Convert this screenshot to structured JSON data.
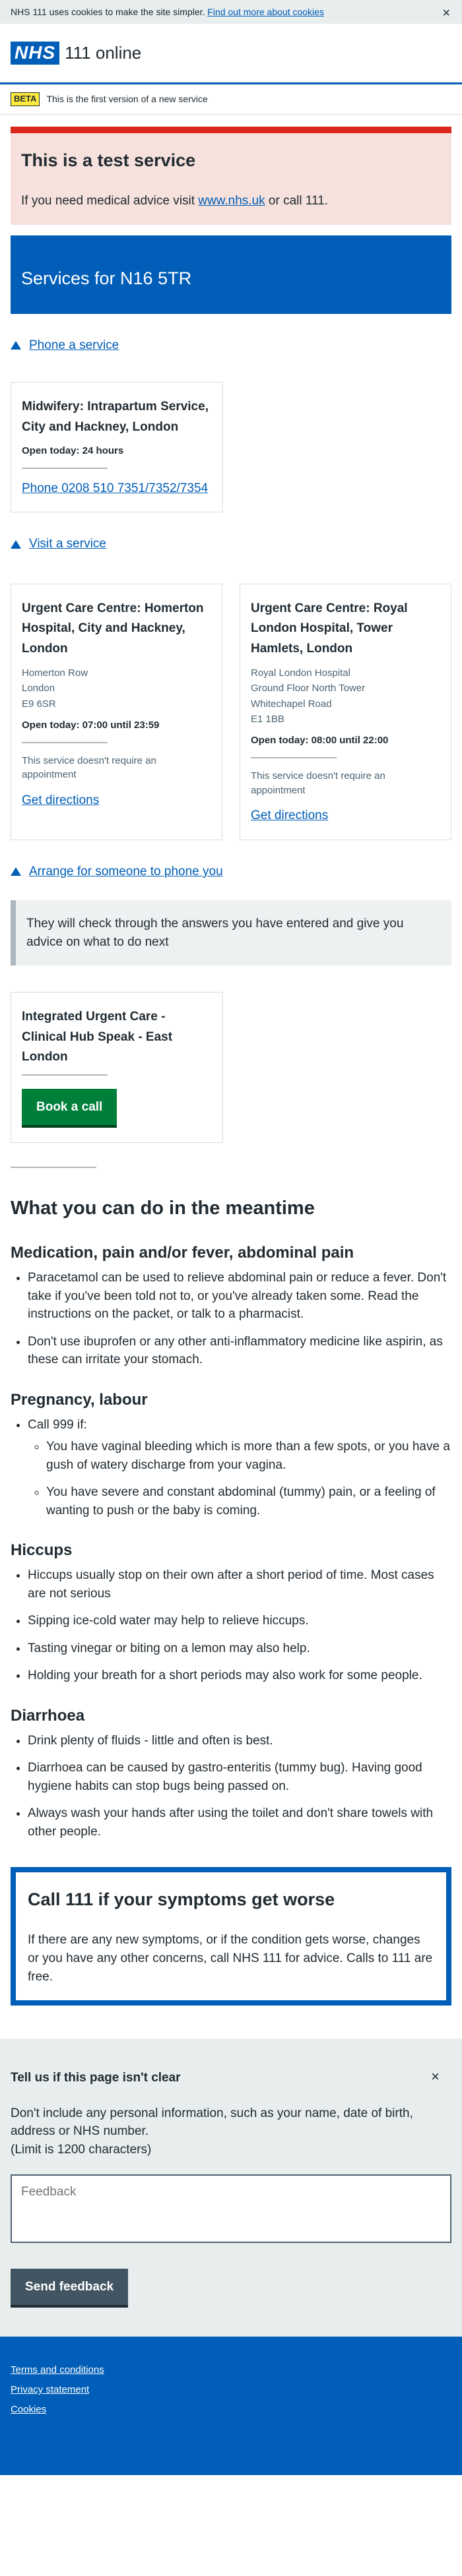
{
  "cookie_banner": {
    "text": "NHS 111 uses cookies to make the site simpler.",
    "link": "Find out more about cookies",
    "close": "×"
  },
  "header": {
    "logo": "NHS",
    "title": "111 online"
  },
  "beta": {
    "tag": "BETA",
    "text": "This is the first version of a new service"
  },
  "test_service": {
    "heading": "This is a test service",
    "prefix": "If you need medical advice visit",
    "link": "www.nhs.uk",
    "suffix": "or call 111."
  },
  "services_heading": "Services for N16 5TR",
  "phone_section": {
    "toggle": "Phone a service",
    "card": {
      "name": "Midwifery: Intrapartum Service, City and Hackney, London",
      "open": "Open today: 24 hours",
      "link": "Phone 0208 510 7351/7352/7354"
    }
  },
  "visit_section": {
    "toggle": "Visit a service",
    "cards": [
      {
        "name": "Urgent Care Centre: Homerton Hospital, City and Hackney, London",
        "address": [
          "Homerton Row",
          "London",
          "E9 6SR"
        ],
        "open": "Open today: 07:00 until 23:59",
        "note": "This service doesn't require an appointment",
        "link": "Get directions"
      },
      {
        "name": "Urgent Care Centre: Royal London Hospital, Tower Hamlets, London",
        "address": [
          "Royal London Hospital",
          "Ground Floor North Tower",
          "Whitechapel Road",
          "E1 1BB"
        ],
        "open": "Open today: 08:00 until 22:00",
        "note": "This service doesn't require an appointment",
        "link": "Get directions"
      }
    ]
  },
  "callback_section": {
    "toggle": "Arrange for someone to phone you",
    "inset": "They will check through the answers you have entered and give you advice on what to do next",
    "card": {
      "name": "Integrated Urgent Care - Clinical Hub Speak - East London",
      "button": "Book a call"
    }
  },
  "meantime": {
    "heading": "What you can do in the meantime",
    "topics": [
      {
        "title": "Medication, pain and/or fever, abdominal pain",
        "items": [
          "Paracetamol can be used to relieve abdominal pain or reduce a fever. Don't take if you've been told not to, or you've already taken some. Read the instructions on the packet, or talk to a pharmacist.",
          "Don't use ibuprofen or any other anti-inflammatory medicine like aspirin, as these can irritate your stomach."
        ]
      },
      {
        "title": "Pregnancy, labour",
        "lead": "Call 999 if:",
        "subitems": [
          "You have vaginal bleeding which is more than a few spots, or you have a gush of watery discharge from your vagina.",
          "You have severe and constant abdominal (tummy) pain, or a feeling of wanting to push or the baby is coming."
        ]
      },
      {
        "title": "Hiccups",
        "items": [
          "Hiccups usually stop on their own after a short period of time. Most cases are not serious",
          "Sipping ice-cold water may help to relieve hiccups.",
          "Tasting vinegar or biting on a lemon may also help.",
          "Holding your breath for a short periods may also work for some people."
        ]
      },
      {
        "title": "Diarrhoea",
        "items": [
          "Drink plenty of fluids - little and often is best.",
          "Diarrhoea can be caused by gastro-enteritis (tummy bug). Having good hygiene habits can stop bugs being passed on.",
          "Always wash your hands after using the toilet and don't share towels with other people."
        ]
      }
    ]
  },
  "care_card": {
    "heading": "Call 111 if your symptoms get worse",
    "text": "If there are any new symptoms, or if the condition gets worse, changes or you have any other concerns, call NHS 111 for advice. Calls to 111 are free."
  },
  "feedback": {
    "heading": "Tell us if this page isn't clear",
    "close": "×",
    "text1": "Don't include any personal information, such as your name, date of birth, address or NHS number.",
    "text2": "(Limit is 1200 characters)",
    "placeholder": "Feedback",
    "button": "Send feedback"
  },
  "footer": {
    "links": [
      "Terms and conditions",
      "Privacy statement",
      "Cookies"
    ]
  }
}
